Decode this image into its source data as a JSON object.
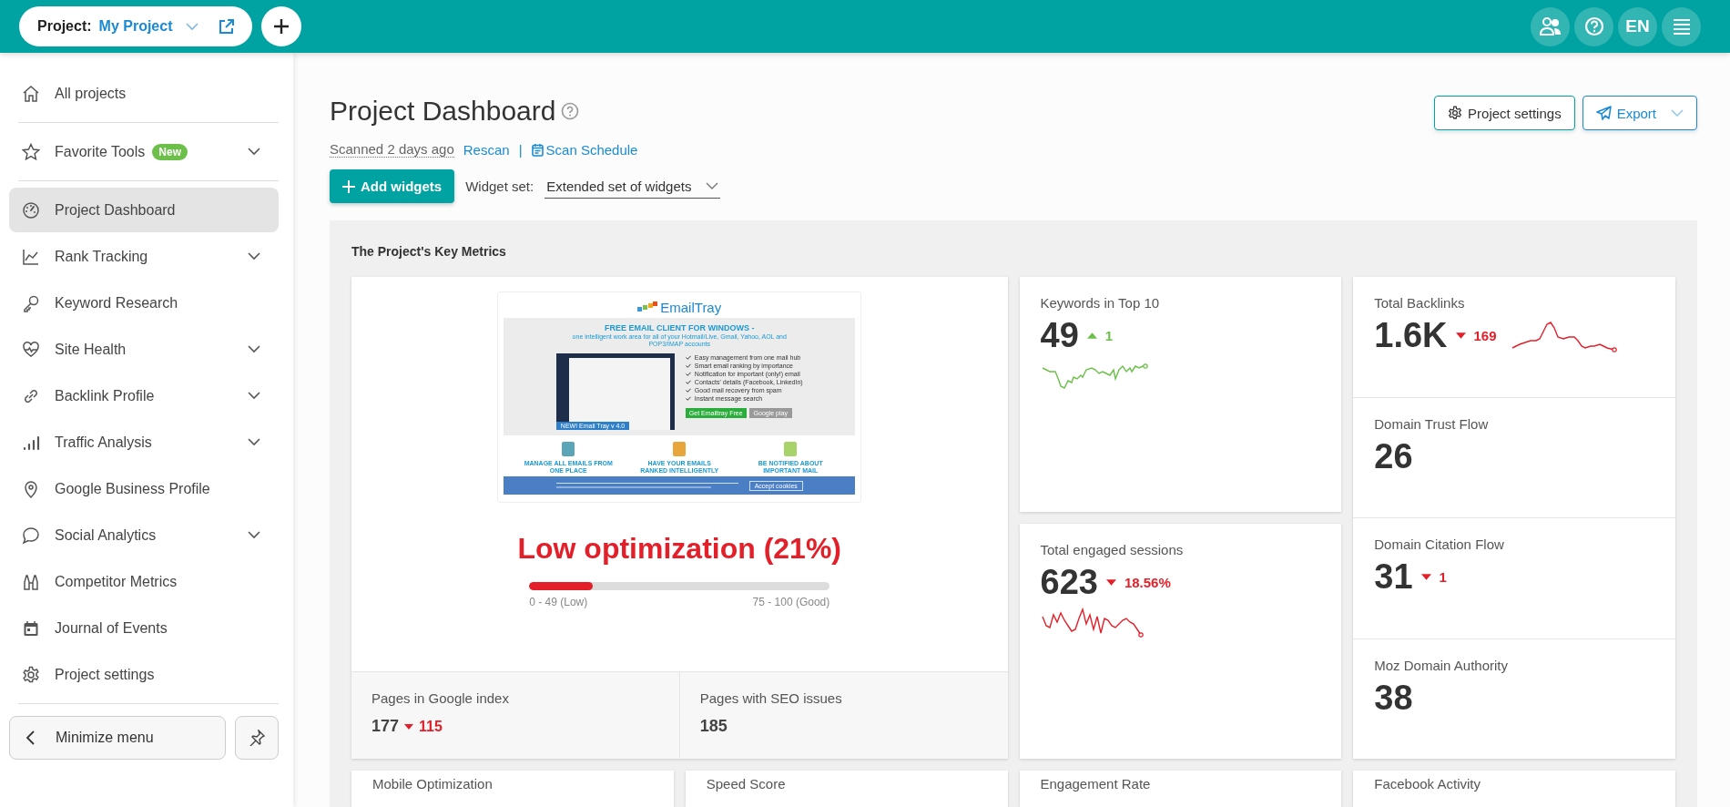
{
  "topbar": {
    "project_label": "Project:",
    "project_name": "My Project",
    "language": "EN"
  },
  "sidebar": {
    "groups": [
      [
        {
          "label": "All projects",
          "selected": false,
          "expandable": false
        }
      ],
      [
        {
          "label": "Favorite Tools",
          "badge": "New",
          "selected": false,
          "expandable": true
        }
      ],
      [
        {
          "label": "Project Dashboard",
          "selected": true,
          "expandable": false
        },
        {
          "label": "Rank Tracking",
          "selected": false,
          "expandable": true
        },
        {
          "label": "Keyword Research",
          "selected": false,
          "expandable": false
        },
        {
          "label": "Site Health",
          "selected": false,
          "expandable": true
        },
        {
          "label": "Backlink Profile",
          "selected": false,
          "expandable": true
        },
        {
          "label": "Traffic Analysis",
          "selected": false,
          "expandable": true
        },
        {
          "label": "Google Business Profile",
          "selected": false,
          "expandable": false
        },
        {
          "label": "Social Analytics",
          "selected": false,
          "expandable": true
        },
        {
          "label": "Competitor Metrics",
          "selected": false,
          "expandable": false
        },
        {
          "label": "Journal of Events",
          "selected": false,
          "expandable": false
        },
        {
          "label": "Project settings",
          "selected": false,
          "expandable": false
        }
      ]
    ],
    "minimize": "Minimize menu"
  },
  "header": {
    "title": "Project Dashboard",
    "scanned": "Scanned 2 days ago",
    "rescan": "Rescan",
    "separator": "|",
    "schedule": "Scan Schedule",
    "add_widgets": "Add widgets",
    "widget_set_label": "Widget set:",
    "widget_set": "Extended set of widgets",
    "settings_button": "Project settings",
    "export_button": "Export"
  },
  "panel": {
    "title": "The Project's Key Metrics",
    "site_preview": {
      "logo": "EmailTray",
      "headline": "FREE EMAIL CLIENT FOR WINDOWS -",
      "subline": "one intelligent work area for all of your Hotmail/Live, Gmail, Yahoo, AOL and POP3/IMAP accounts",
      "app_caption": "NEW! Email Tray v 4.0",
      "features": [
        "Easy management from one mail hub",
        "Smart email ranking by importance",
        "Notification for important (only!) email",
        "Contacts' details (Facebook, LinkedIn)",
        "Good mail recovery from spam",
        "Instant message search"
      ],
      "cta": "Get Emailtray Free",
      "store": "Google play",
      "captions": [
        "MANAGE ALL EMAILS FROM ONE PLACE",
        "HAVE YOUR EMAILS RANKED INTELLIGENTLY",
        "BE NOTIFIED ABOUT IMPORTANT MAIL"
      ],
      "cookie_button": "Accept cookies"
    },
    "optimization": {
      "headline": "Low optimization (21%)",
      "level": 0.21,
      "low_range": "0 - 49 (Low)",
      "high_range": "75 - 100 (Good)"
    },
    "stats": [
      {
        "label": "Pages in Google index",
        "value": "177",
        "rising": false,
        "change": "115"
      },
      {
        "label": "Pages with SEO issues",
        "value": "185"
      }
    ],
    "metrics": [
      {
        "label": "Keywords in Top 10",
        "value": "49",
        "rising": true,
        "change": "1"
      },
      {
        "label": "Total engaged sessions",
        "value": "623",
        "rising": false,
        "change": "18.56%"
      }
    ],
    "authority": [
      {
        "label": "Total Backlinks",
        "value": "1.6K",
        "rising": false,
        "change": "169"
      },
      {
        "label": "Domain Trust Flow",
        "value": "26"
      },
      {
        "label": "Domain Citation Flow",
        "value": "31",
        "rising": false,
        "change": "1"
      },
      {
        "label": "Moz Domain Authority",
        "value": "38"
      }
    ],
    "more_widgets": [
      "Mobile Optimization",
      "Speed Score",
      "Engagement Rate",
      "Facebook Activity"
    ]
  }
}
